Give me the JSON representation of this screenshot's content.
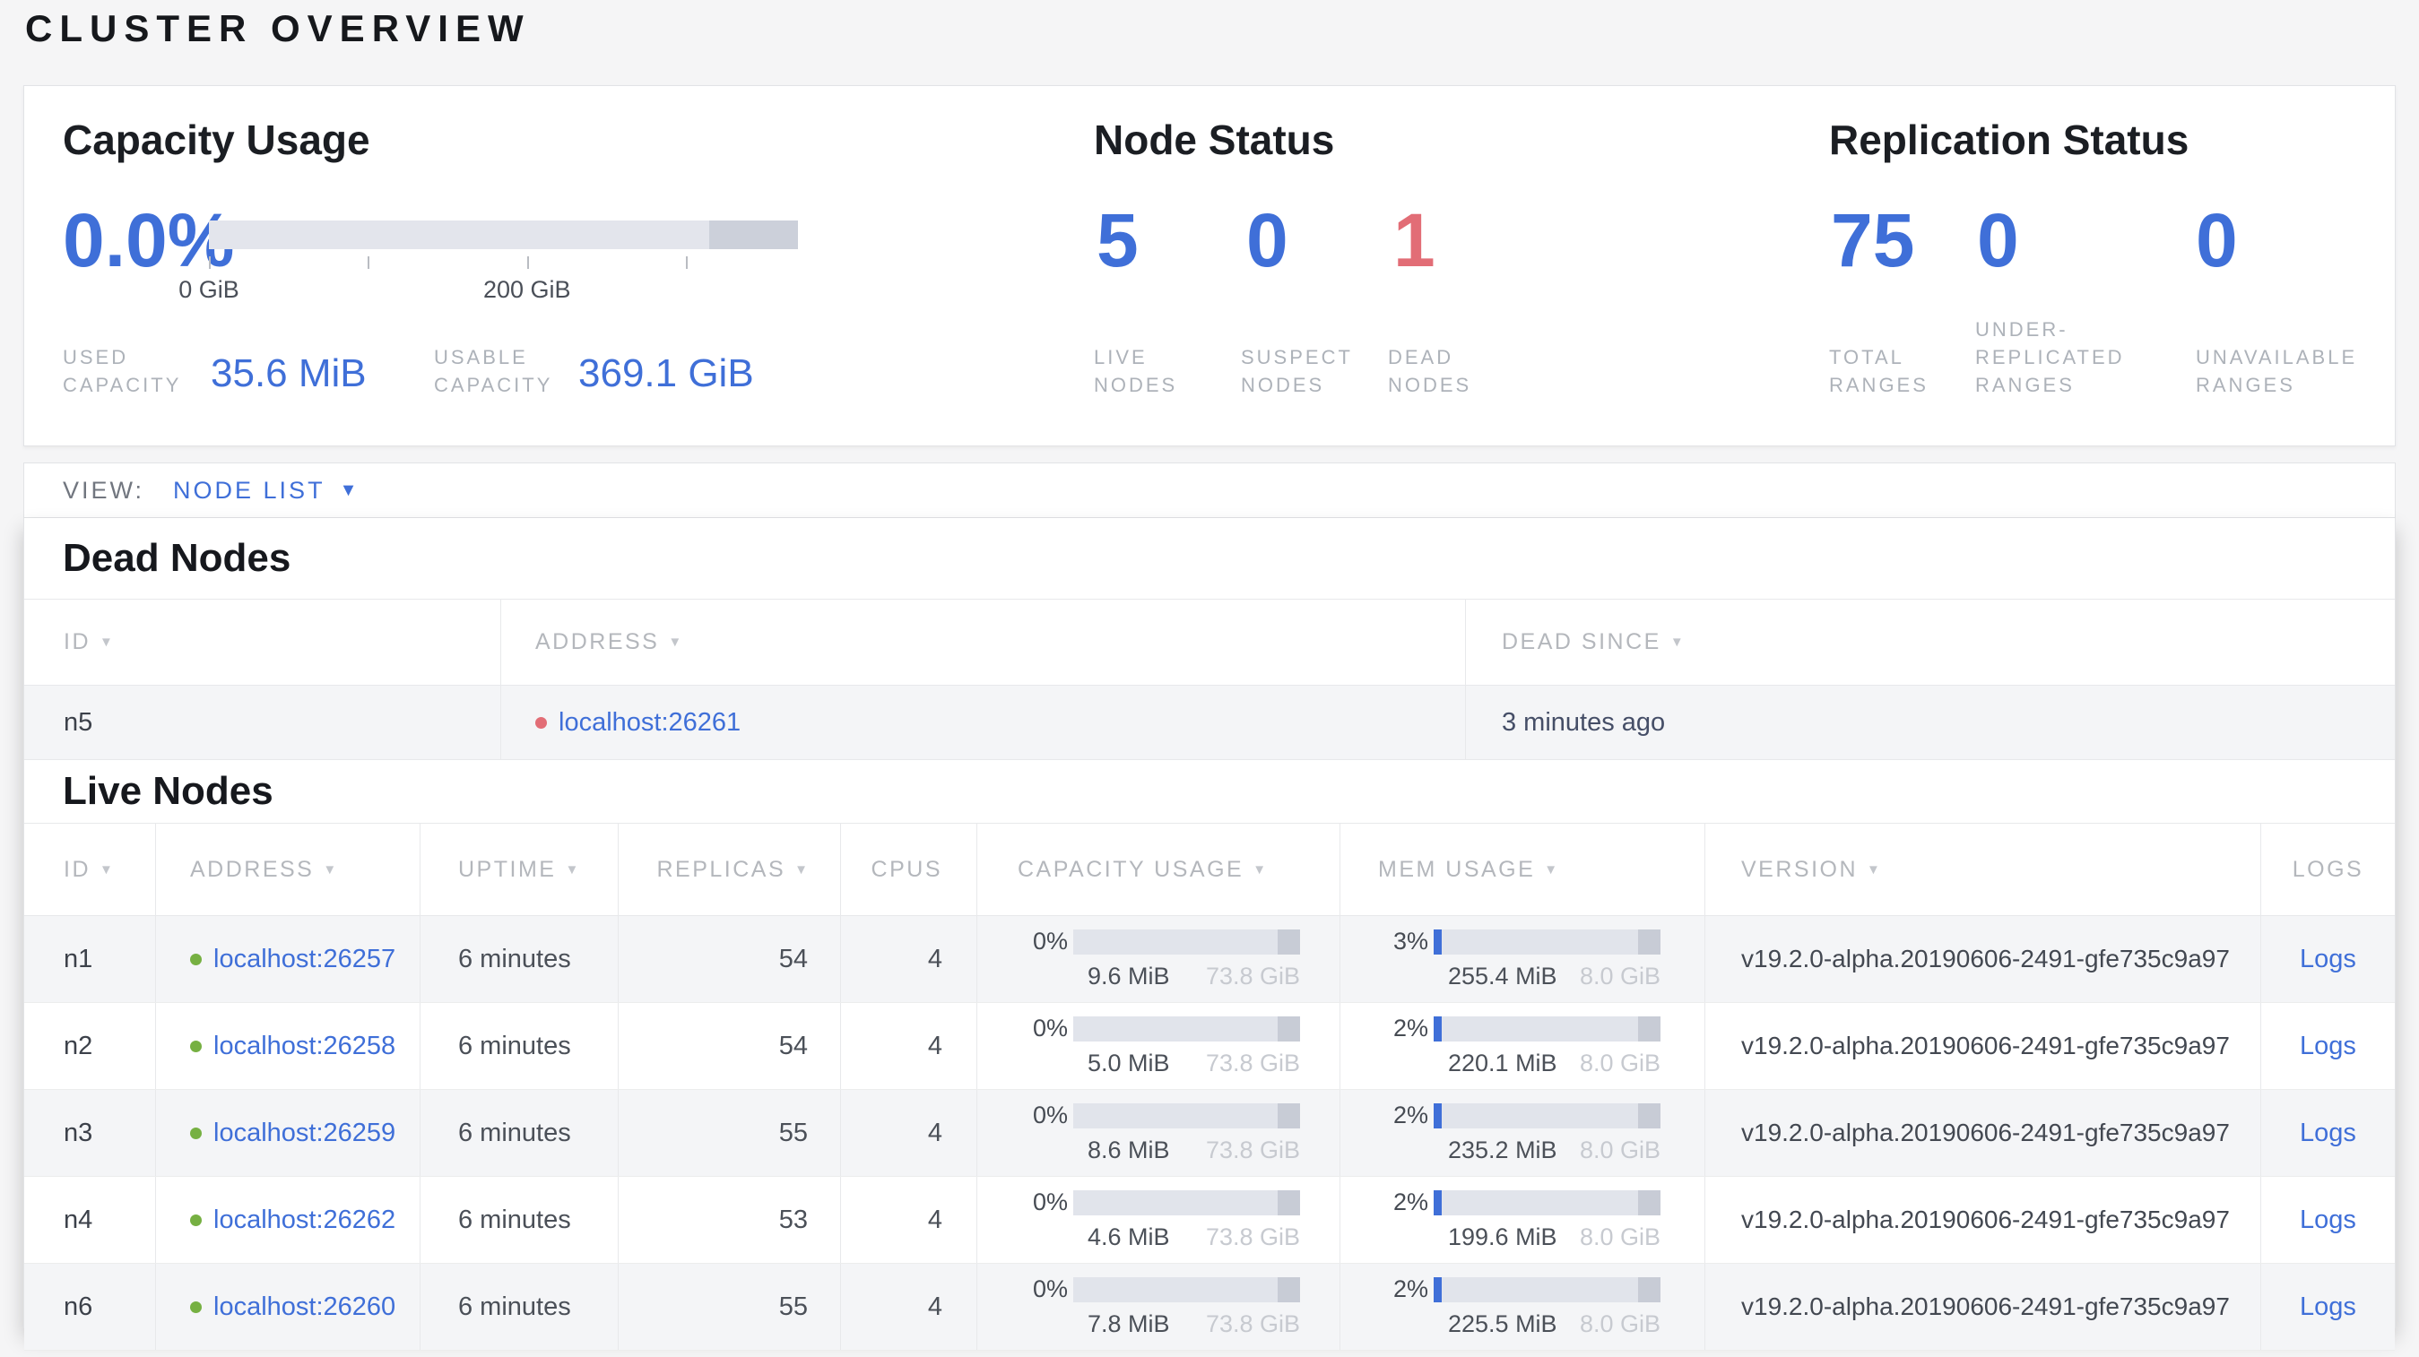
{
  "page": {
    "title": "CLUSTER OVERVIEW"
  },
  "colors": {
    "accent_blue": "#3f6fd8",
    "danger_red": "#e26d76",
    "live_green": "#76b042"
  },
  "icons": {
    "sort_desc": "▼",
    "dropdown_caret": "▼"
  },
  "overview": {
    "capacity": {
      "title": "Capacity Usage",
      "percent": "0.0%",
      "bar": {
        "fill_pct": 0,
        "ticks": [
          {
            "pos": 0,
            "label": "0 GiB"
          },
          {
            "pos": 27,
            "label": ""
          },
          {
            "pos": 54,
            "label": "200 GiB"
          },
          {
            "pos": 81,
            "label": ""
          }
        ]
      },
      "used": {
        "label": "USED CAPACITY",
        "value": "35.6 MiB"
      },
      "usable": {
        "label": "USABLE CAPACITY",
        "value": "369.1 GiB"
      }
    },
    "node_status": {
      "title": "Node Status",
      "live": {
        "value": "5",
        "label": "LIVE NODES"
      },
      "suspect": {
        "value": "0",
        "label": "SUSPECT NODES"
      },
      "dead": {
        "value": "1",
        "label": "DEAD NODES"
      }
    },
    "replication": {
      "title": "Replication Status",
      "total": {
        "value": "75",
        "label": "TOTAL RANGES"
      },
      "under": {
        "value": "0",
        "label": "UNDER-REPLICATED RANGES"
      },
      "unavailable": {
        "value": "0",
        "label": "UNAVAILABLE RANGES"
      }
    }
  },
  "view_bar": {
    "label": "VIEW:",
    "selected": "NODE LIST"
  },
  "dead_nodes": {
    "title": "Dead Nodes",
    "headers": {
      "id": "ID",
      "address": "ADDRESS",
      "dead_since": "DEAD SINCE"
    },
    "rows": [
      {
        "id": "n5",
        "address": "localhost:26261",
        "dead_since": "3 minutes ago"
      }
    ]
  },
  "live_nodes": {
    "title": "Live Nodes",
    "headers": {
      "id": "ID",
      "address": "ADDRESS",
      "uptime": "UPTIME",
      "replicas": "REPLICAS",
      "cpus": "CPUS",
      "capacity": "CAPACITY USAGE",
      "mem": "MEM USAGE",
      "version": "VERSION",
      "logs": "LOGS"
    },
    "rows": [
      {
        "id": "n1",
        "address": "localhost:26257",
        "uptime": "6 minutes",
        "replicas": "54",
        "cpus": "4",
        "capacity": {
          "pct": "0%",
          "fill": 0,
          "used": "9.6 MiB",
          "total": "73.8 GiB"
        },
        "mem": {
          "pct": "3%",
          "fill": 3,
          "used": "255.4 MiB",
          "total": "8.0 GiB"
        },
        "version": "v19.2.0-alpha.20190606-2491-gfe735c9a97",
        "logs": "Logs"
      },
      {
        "id": "n2",
        "address": "localhost:26258",
        "uptime": "6 minutes",
        "replicas": "54",
        "cpus": "4",
        "capacity": {
          "pct": "0%",
          "fill": 0,
          "used": "5.0 MiB",
          "total": "73.8 GiB"
        },
        "mem": {
          "pct": "2%",
          "fill": 2,
          "used": "220.1 MiB",
          "total": "8.0 GiB"
        },
        "version": "v19.2.0-alpha.20190606-2491-gfe735c9a97",
        "logs": "Logs"
      },
      {
        "id": "n3",
        "address": "localhost:26259",
        "uptime": "6 minutes",
        "replicas": "55",
        "cpus": "4",
        "capacity": {
          "pct": "0%",
          "fill": 0,
          "used": "8.6 MiB",
          "total": "73.8 GiB"
        },
        "mem": {
          "pct": "2%",
          "fill": 2,
          "used": "235.2 MiB",
          "total": "8.0 GiB"
        },
        "version": "v19.2.0-alpha.20190606-2491-gfe735c9a97",
        "logs": "Logs"
      },
      {
        "id": "n4",
        "address": "localhost:26262",
        "uptime": "6 minutes",
        "replicas": "53",
        "cpus": "4",
        "capacity": {
          "pct": "0%",
          "fill": 0,
          "used": "4.6 MiB",
          "total": "73.8 GiB"
        },
        "mem": {
          "pct": "2%",
          "fill": 2,
          "used": "199.6 MiB",
          "total": "8.0 GiB"
        },
        "version": "v19.2.0-alpha.20190606-2491-gfe735c9a97",
        "logs": "Logs"
      },
      {
        "id": "n6",
        "address": "localhost:26260",
        "uptime": "6 minutes",
        "replicas": "55",
        "cpus": "4",
        "capacity": {
          "pct": "0%",
          "fill": 0,
          "used": "7.8 MiB",
          "total": "73.8 GiB"
        },
        "mem": {
          "pct": "2%",
          "fill": 2,
          "used": "225.5 MiB",
          "total": "8.0 GiB"
        },
        "version": "v19.2.0-alpha.20190606-2491-gfe735c9a97",
        "logs": "Logs"
      }
    ]
  }
}
